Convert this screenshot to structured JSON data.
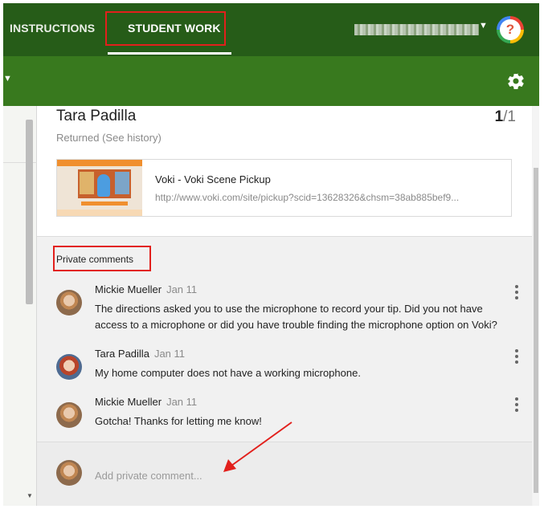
{
  "tabs": {
    "instructions": "INSTRUCTIONS",
    "student_work": "STUDENT WORK"
  },
  "student": {
    "name": "Tara Padilla",
    "page_current": "1",
    "page_total": "/1",
    "status": "Returned (See history)"
  },
  "attachment": {
    "title": "Voki - Voki Scene Pickup",
    "url": "http://www.voki.com/site/pickup?scid=13628326&chsm=38ab885bef9..."
  },
  "private_comments": {
    "label": "Private comments",
    "items": [
      {
        "author": "Mickie Mueller",
        "date": "Jan 11",
        "text": "The directions asked you to use the microphone to record your tip. Did you not have access to a microphone or did you have trouble finding the microphone option on Voki?",
        "avatar": "mickie"
      },
      {
        "author": "Tara Padilla",
        "date": "Jan 11",
        "text": "My home computer does not have a working microphone.",
        "avatar": "tara"
      },
      {
        "author": "Mickie Mueller",
        "date": "Jan 11",
        "text": "Gotcha! Thanks for letting me know!",
        "avatar": "mickie"
      }
    ],
    "composer_placeholder": "Add private comment..."
  },
  "icons": {
    "help": "?",
    "settings": "gear-icon",
    "more": "more-vert-icon"
  },
  "colors": {
    "top_bar": "#265c18",
    "sub_bar": "#38791e",
    "annotation_red": "#e2201c"
  }
}
